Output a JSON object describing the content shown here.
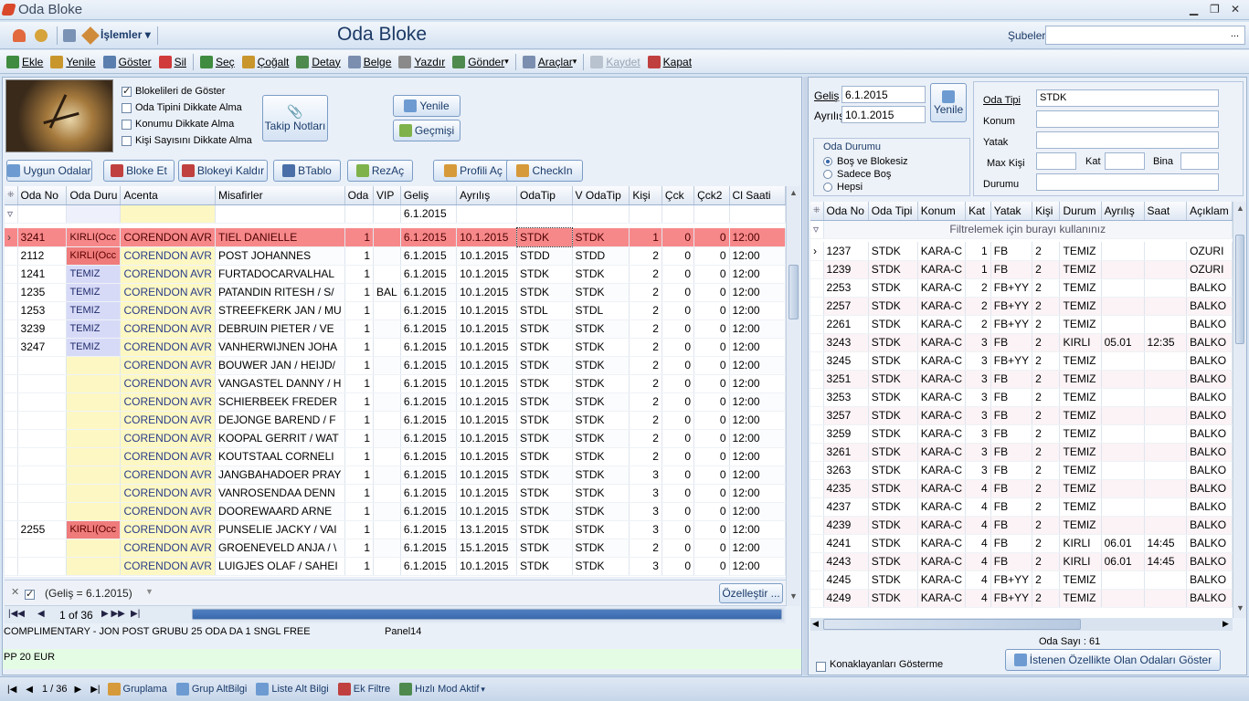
{
  "window": {
    "title": "Oda Bloke",
    "min": "▁",
    "max": "❐",
    "close": "✕"
  },
  "menubar": {
    "islemler": "İşlemler",
    "form_title": "Oda Bloke",
    "subeler_label": "Şubeler",
    "subeler_value": "..."
  },
  "toolbar": {
    "items": [
      {
        "label": "Ekle",
        "icon": "add-icon",
        "color": "#3f8b3f"
      },
      {
        "label": "Yenile",
        "icon": "pencil-icon",
        "color": "#c9962c"
      },
      {
        "label": "Göster",
        "icon": "magnifier-icon",
        "color": "#5a7fae"
      },
      {
        "label": "Sil",
        "icon": "delete-icon",
        "color": "#d03a3a"
      },
      {
        "label": "Seç",
        "icon": "select-icon",
        "color": "#3f8b3f"
      },
      {
        "label": "Çoğalt",
        "icon": "copy-icon",
        "color": "#c9962c"
      },
      {
        "label": "Detay",
        "icon": "detail-icon",
        "color": "#4e8a4e"
      },
      {
        "label": "Belge",
        "icon": "document-icon",
        "color": "#7b8eb0"
      },
      {
        "label": "Yazdır",
        "icon": "printer-icon",
        "color": "#8a8a8a"
      },
      {
        "label": "Gönder",
        "icon": "send-icon",
        "color": "#4e8a4e"
      },
      {
        "label": "Araçlar",
        "icon": "tools-icon",
        "color": "#7b8eb0"
      },
      {
        "label": "Kaydet",
        "icon": "save-icon",
        "color": "#b9c2cf"
      },
      {
        "label": "Kapat",
        "icon": "close-icon",
        "color": "#c04040"
      }
    ]
  },
  "left": {
    "checks": [
      {
        "label": "Blokelileri de Göster",
        "checked": true
      },
      {
        "label": "Oda Tipini Dikkate Alma",
        "checked": false
      },
      {
        "label": "Konumu Dikkate Alma",
        "checked": false
      },
      {
        "label": "Kişi Sayısını Dikkate Alma",
        "checked": false
      }
    ],
    "takip_notlari": "Takip Notları",
    "yenile": "Yenile",
    "gecmisi": "Geçmişi",
    "actions": [
      "Uygun Odalar",
      "Bloke Et",
      "Blokeyi Kaldır",
      "BTablo",
      "RezAç",
      "Profili Aç",
      "CheckIn"
    ],
    "columns": [
      "Oda No",
      "Oda Duru",
      "Acenta",
      "Misafirler",
      "Oda",
      "VIP",
      "Geliş",
      "Ayrılış",
      "OdaTip",
      "V OdaTip",
      "Kişi",
      "Çck",
      "Çck2",
      "Cl Saati"
    ],
    "filter_gelis": "6.1.2015",
    "rows": [
      [
        "3241",
        "KIRLI(Occ",
        "CORENDON AVR",
        "TIEL DANIELLE",
        "1",
        "",
        "6.1.2015",
        "10.1.2015",
        "STDK",
        "STDK",
        "1",
        "0",
        "0",
        "12:00"
      ],
      [
        "2112",
        "KIRLI(Occ",
        "CORENDON AVR",
        "POST JOHANNES",
        "1",
        "",
        "6.1.2015",
        "10.1.2015",
        "STDD",
        "STDD",
        "2",
        "0",
        "0",
        "12:00"
      ],
      [
        "1241",
        "TEMIZ",
        "CORENDON AVR",
        "FURTADOCARVALHAL",
        "1",
        "",
        "6.1.2015",
        "10.1.2015",
        "STDK",
        "STDK",
        "2",
        "0",
        "0",
        "12:00"
      ],
      [
        "1235",
        "TEMIZ",
        "CORENDON AVR",
        "PATANDIN RITESH / S/",
        "1",
        "BAL",
        "6.1.2015",
        "10.1.2015",
        "STDK",
        "STDK",
        "2",
        "0",
        "0",
        "12:00"
      ],
      [
        "1253",
        "TEMIZ",
        "CORENDON AVR",
        "STREEFKERK JAN / MU",
        "1",
        "",
        "6.1.2015",
        "10.1.2015",
        "STDL",
        "STDL",
        "2",
        "0",
        "0",
        "12:00"
      ],
      [
        "3239",
        "TEMIZ",
        "CORENDON AVR",
        "DEBRUIN PIETER / VE",
        "1",
        "",
        "6.1.2015",
        "10.1.2015",
        "STDK",
        "STDK",
        "2",
        "0",
        "0",
        "12:00"
      ],
      [
        "3247",
        "TEMIZ",
        "CORENDON AVR",
        "VANHERWIJNEN JOHA",
        "1",
        "",
        "6.1.2015",
        "10.1.2015",
        "STDK",
        "STDK",
        "2",
        "0",
        "0",
        "12:00"
      ],
      [
        "",
        "",
        "CORENDON AVR",
        "BOUWER JAN / HEIJD/",
        "1",
        "",
        "6.1.2015",
        "10.1.2015",
        "STDK",
        "STDK",
        "2",
        "0",
        "0",
        "12:00"
      ],
      [
        "",
        "",
        "CORENDON AVR",
        "VANGASTEL DANNY / H",
        "1",
        "",
        "6.1.2015",
        "10.1.2015",
        "STDK",
        "STDK",
        "2",
        "0",
        "0",
        "12:00"
      ],
      [
        "",
        "",
        "CORENDON AVR",
        "SCHIERBEEK FREDER",
        "1",
        "",
        "6.1.2015",
        "10.1.2015",
        "STDK",
        "STDK",
        "2",
        "0",
        "0",
        "12:00"
      ],
      [
        "",
        "",
        "CORENDON AVR",
        "DEJONGE BAREND / F",
        "1",
        "",
        "6.1.2015",
        "10.1.2015",
        "STDK",
        "STDK",
        "2",
        "0",
        "0",
        "12:00"
      ],
      [
        "",
        "",
        "CORENDON AVR",
        "KOOPAL GERRIT / WAT",
        "1",
        "",
        "6.1.2015",
        "10.1.2015",
        "STDK",
        "STDK",
        "2",
        "0",
        "0",
        "12:00"
      ],
      [
        "",
        "",
        "CORENDON AVR",
        "KOUTSTAAL CORNELI",
        "1",
        "",
        "6.1.2015",
        "10.1.2015",
        "STDK",
        "STDK",
        "2",
        "0",
        "0",
        "12:00"
      ],
      [
        "",
        "",
        "CORENDON AVR",
        "JANGBAHADOER PRAY",
        "1",
        "",
        "6.1.2015",
        "10.1.2015",
        "STDK",
        "STDK",
        "3",
        "0",
        "0",
        "12:00"
      ],
      [
        "",
        "",
        "CORENDON AVR",
        "VANROSENDAA DENN",
        "1",
        "",
        "6.1.2015",
        "10.1.2015",
        "STDK",
        "STDK",
        "3",
        "0",
        "0",
        "12:00"
      ],
      [
        "",
        "",
        "CORENDON AVR",
        "DOOREWAARD ARNE",
        "1",
        "",
        "6.1.2015",
        "10.1.2015",
        "STDK",
        "STDK",
        "3",
        "0",
        "0",
        "12:00"
      ],
      [
        "2255",
        "KIRLI(Occ",
        "CORENDON AVR",
        "PUNSELIE JACKY / VAI",
        "1",
        "",
        "6.1.2015",
        "13.1.2015",
        "STDK",
        "STDK",
        "3",
        "0",
        "0",
        "12:00"
      ],
      [
        "",
        "",
        "CORENDON AVR",
        "GROENEVELD ANJA / \\",
        "1",
        "",
        "6.1.2015",
        "15.1.2015",
        "STDK",
        "STDK",
        "2",
        "0",
        "0",
        "12:00"
      ],
      [
        "",
        "",
        "CORENDON AVR",
        "LUIGJES OLAF / SAHEI",
        "1",
        "",
        "6.1.2015",
        "10.1.2015",
        "STDK",
        "STDK",
        "3",
        "0",
        "0",
        "12:00"
      ]
    ],
    "filter_text": "(Geliş = 6.1.2015)",
    "ozellestir": "Özelleştir ...",
    "pager": "1 of 36",
    "note1": "COMPLIMENTARY - JON POST GRUBU 25 ODA DA 1 SNGL FREE",
    "panel14": "Panel14",
    "note2": "PP 20 EUR"
  },
  "right": {
    "gelis_label": "Geliş",
    "gelis_value": "6.1.2015",
    "ayrilis_label": "Ayrılış",
    "ayrilis_value": "10.1.2015",
    "yenile": "Yenile",
    "oda_durumu": "Oda Durumu",
    "radios": [
      {
        "label": "Boş ve Blokesiz",
        "checked": true
      },
      {
        "label": "Sadece Boş",
        "checked": false
      },
      {
        "label": "Hepsi",
        "checked": false
      }
    ],
    "oda_tipi_label": "Oda Tipi",
    "oda_tipi_value": "STDK",
    "konum_label": "Konum",
    "yatak_label": "Yatak",
    "max_kisi_label": "Max Kişi",
    "kat_label": "Kat",
    "bina_label": "Bina",
    "durumu_label": "Durumu",
    "columns": [
      "Oda No",
      "Oda Tipi",
      "Konum",
      "Kat",
      "Yatak",
      "Kişi",
      "Durum",
      "Ayrılış",
      "Saat",
      "Açıklam"
    ],
    "filter_hint": "Filtrelemek için burayı kullanınız",
    "rows": [
      [
        "1237",
        "STDK",
        "KARA-C",
        "1",
        "FB",
        "2",
        "TEMIZ",
        "",
        "",
        "OZURI"
      ],
      [
        "1239",
        "STDK",
        "KARA-C",
        "1",
        "FB",
        "2",
        "TEMIZ",
        "",
        "",
        "OZURI"
      ],
      [
        "2253",
        "STDK",
        "KARA-C",
        "2",
        "FB+YY",
        "2",
        "TEMIZ",
        "",
        "",
        "BALKO"
      ],
      [
        "2257",
        "STDK",
        "KARA-C",
        "2",
        "FB+YY",
        "2",
        "TEMIZ",
        "",
        "",
        "BALKO"
      ],
      [
        "2261",
        "STDK",
        "KARA-C",
        "2",
        "FB+YY",
        "2",
        "TEMIZ",
        "",
        "",
        "BALKO"
      ],
      [
        "3243",
        "STDK",
        "KARA-C",
        "3",
        "FB",
        "2",
        "KIRLI",
        "05.01",
        "12:35",
        "BALKO"
      ],
      [
        "3245",
        "STDK",
        "KARA-C",
        "3",
        "FB+YY",
        "2",
        "TEMIZ",
        "",
        "",
        "BALKO"
      ],
      [
        "3251",
        "STDK",
        "KARA-C",
        "3",
        "FB",
        "2",
        "TEMIZ",
        "",
        "",
        "BALKO"
      ],
      [
        "3253",
        "STDK",
        "KARA-C",
        "3",
        "FB",
        "2",
        "TEMIZ",
        "",
        "",
        "BALKO"
      ],
      [
        "3257",
        "STDK",
        "KARA-C",
        "3",
        "FB",
        "2",
        "TEMIZ",
        "",
        "",
        "BALKO"
      ],
      [
        "3259",
        "STDK",
        "KARA-C",
        "3",
        "FB",
        "2",
        "TEMIZ",
        "",
        "",
        "BALKO"
      ],
      [
        "3261",
        "STDK",
        "KARA-C",
        "3",
        "FB",
        "2",
        "TEMIZ",
        "",
        "",
        "BALKO"
      ],
      [
        "3263",
        "STDK",
        "KARA-C",
        "3",
        "FB",
        "2",
        "TEMIZ",
        "",
        "",
        "BALKO"
      ],
      [
        "4235",
        "STDK",
        "KARA-C",
        "4",
        "FB",
        "2",
        "TEMIZ",
        "",
        "",
        "BALKO"
      ],
      [
        "4237",
        "STDK",
        "KARA-C",
        "4",
        "FB",
        "2",
        "TEMIZ",
        "",
        "",
        "BALKO"
      ],
      [
        "4239",
        "STDK",
        "KARA-C",
        "4",
        "FB",
        "2",
        "TEMIZ",
        "",
        "",
        "BALKO"
      ],
      [
        "4241",
        "STDK",
        "KARA-C",
        "4",
        "FB",
        "2",
        "KIRLI",
        "06.01",
        "14:45",
        "BALKO"
      ],
      [
        "4243",
        "STDK",
        "KARA-C",
        "4",
        "FB",
        "2",
        "KIRLI",
        "06.01",
        "14:45",
        "BALKO"
      ],
      [
        "4245",
        "STDK",
        "KARA-C",
        "4",
        "FB+YY",
        "2",
        "TEMIZ",
        "",
        "",
        "BALKO"
      ],
      [
        "4249",
        "STDK",
        "KARA-C",
        "4",
        "FB+YY",
        "2",
        "TEMIZ",
        "",
        "",
        "BALKO"
      ]
    ],
    "oda_sayi": "Oda Sayı : 61",
    "konaklayanlari": "Konaklayanları Gösterme",
    "istenen": "İstenen Özellikte Olan Odaları Göster"
  },
  "statusbar": {
    "pager": "1 / 36",
    "items": [
      "Gruplama",
      "Grup AltBilgi",
      "Liste Alt Bilgi",
      "Ek Filtre",
      "Hızlı Mod Aktif"
    ]
  }
}
